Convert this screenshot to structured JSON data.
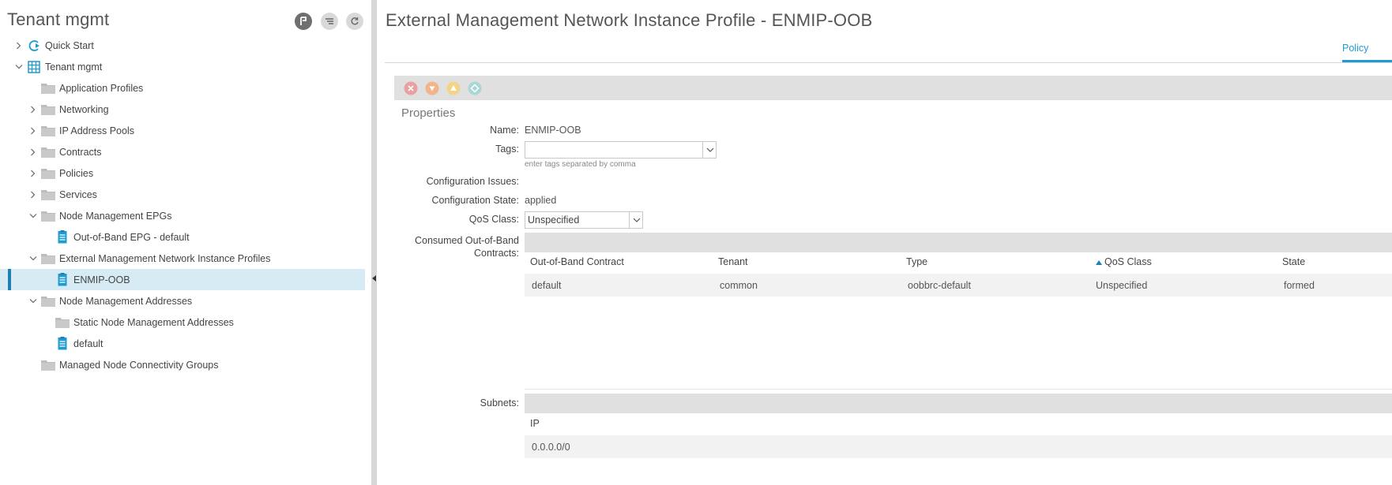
{
  "left": {
    "title": "Tenant mgmt",
    "toolbar": [
      {
        "name": "history-icon"
      },
      {
        "name": "filter-icon"
      },
      {
        "name": "refresh-icon"
      }
    ],
    "tree": [
      {
        "label": "Quick Start",
        "chevron": "right",
        "icon": "quick-start-icon"
      },
      {
        "label": "Tenant mgmt",
        "chevron": "down",
        "icon": "tenant-icon"
      },
      {
        "label": "Application Profiles",
        "chevron": "none",
        "icon": "folder-icon"
      },
      {
        "label": "Networking",
        "chevron": "right",
        "icon": "folder-icon"
      },
      {
        "label": "IP Address Pools",
        "chevron": "right",
        "icon": "folder-icon"
      },
      {
        "label": "Contracts",
        "chevron": "right",
        "icon": "folder-icon"
      },
      {
        "label": "Policies",
        "chevron": "right",
        "icon": "folder-icon"
      },
      {
        "label": "Services",
        "chevron": "right",
        "icon": "folder-icon"
      },
      {
        "label": "Node Management EPGs",
        "chevron": "down",
        "icon": "folder-icon"
      },
      {
        "label": "Out-of-Band EPG - default",
        "chevron": "none",
        "icon": "document-icon"
      },
      {
        "label": "External Management Network Instance Profiles",
        "chevron": "down",
        "icon": "folder-icon"
      },
      {
        "label": "ENMIP-OOB",
        "chevron": "none",
        "icon": "document-icon",
        "selected": true
      },
      {
        "label": "Node Management Addresses",
        "chevron": "down",
        "icon": "folder-icon"
      },
      {
        "label": "Static Node Management Addresses",
        "chevron": "none",
        "icon": "folder-icon"
      },
      {
        "label": "default",
        "chevron": "none",
        "icon": "document-icon"
      },
      {
        "label": "Managed Node Connectivity Groups",
        "chevron": "none",
        "icon": "folder-icon"
      }
    ]
  },
  "main": {
    "title": "External Management Network Instance Profile - ENMIP-OOB",
    "tabs": [
      {
        "label": "Policy",
        "active": true
      }
    ],
    "fault_icons": [
      {
        "name": "critical-fault-icon",
        "color": "#e8a0a0"
      },
      {
        "name": "major-fault-icon",
        "color": "#f0b58a"
      },
      {
        "name": "minor-fault-icon",
        "color": "#f2d488"
      },
      {
        "name": "warning-fault-icon",
        "color": "#a9d6d6"
      }
    ],
    "properties_heading": "Properties",
    "fields": {
      "name_label": "Name:",
      "name_value": "ENMIP-OOB",
      "tags_label": "Tags:",
      "tags_value": "",
      "tags_hint": "enter tags separated by comma",
      "config_issues_label": "Configuration Issues:",
      "config_issues_value": "",
      "config_state_label": "Configuration State:",
      "config_state_value": "applied",
      "qos_label": "QoS Class:",
      "qos_value": "Unspecified",
      "consumed_label_1": "Consumed Out-of-Band",
      "consumed_label_2": "Contracts:",
      "subnets_label": "Subnets:"
    },
    "contracts_table": {
      "columns": [
        "Out-of-Band Contract",
        "Tenant",
        "Type",
        "QoS Class",
        "State"
      ],
      "sorted_column": "QoS Class",
      "rows": [
        [
          "default",
          "common",
          "oobbrc-default",
          "Unspecified",
          "formed"
        ]
      ]
    },
    "subnets_table": {
      "columns": [
        "IP"
      ],
      "rows": [
        [
          "0.0.0.0/0"
        ]
      ]
    }
  }
}
